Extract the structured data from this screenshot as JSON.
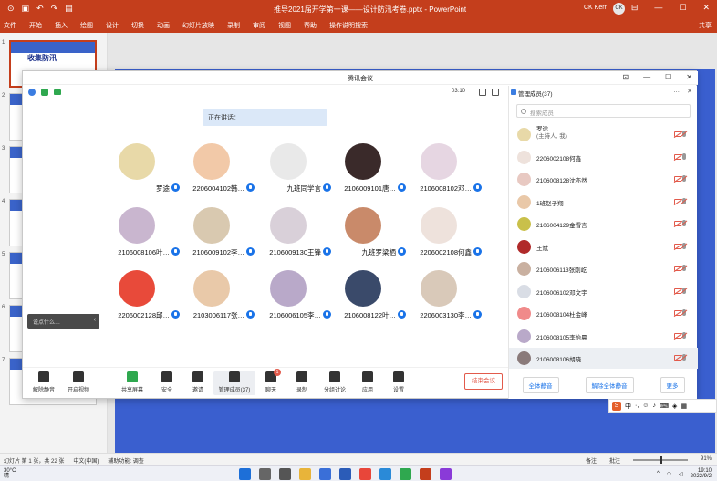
{
  "ppt": {
    "doc_title": "推导2021届开学第一课——设计防汛考卷.pptx - PowerPoint",
    "user_name": "CK Kerr",
    "user_initials": "CK",
    "share": "共享",
    "tabs": [
      "文件",
      "开始",
      "插入",
      "绘图",
      "设计",
      "切换",
      "动画",
      "幻灯片放映",
      "录制",
      "审阅",
      "视图",
      "帮助",
      "操作说明搜索"
    ],
    "thumb_badge": "收集防汛",
    "thumb_numbers": [
      "1",
      "2",
      "3",
      "4",
      "5",
      "6",
      "7"
    ],
    "status_left": [
      "幻灯片 第 1 张，共 22 张",
      "中文(中国)",
      "辅助功能: 调查"
    ],
    "status_right": [
      "备注",
      "批注",
      "91%"
    ]
  },
  "meeting": {
    "title": "腾讯会议",
    "timer": "03:10",
    "toast": "正在讲话：",
    "participants_grid": [
      {
        "label": "罗途",
        "pic": "#e8d9a8"
      },
      {
        "label": "2206004102韩…",
        "pic": "#f2c9a8"
      },
      {
        "label": "九班同学言",
        "pic": "#e9e9e9"
      },
      {
        "label": "2106009101唐…",
        "pic": "#3a2a2a"
      },
      {
        "label": "2106008102邓…",
        "pic": "#e6d6e2"
      },
      {
        "label": "2106008106叶…",
        "pic": "#c9b6cf"
      },
      {
        "label": "2106009102李…",
        "pic": "#d9c9b0"
      },
      {
        "label": "2106009130王锋",
        "pic": "#d9d0d9"
      },
      {
        "label": "九班罗梁栖",
        "pic": "#c98a6a"
      },
      {
        "label": "2206002108何鑫",
        "pic": "#eee2dc"
      },
      {
        "label": "2206002128邱…",
        "pic": "#e84a3a"
      },
      {
        "label": "2103006117张…",
        "pic": "#e9c9a9"
      },
      {
        "label": "2106006105李…",
        "pic": "#b9a9c9"
      },
      {
        "label": "2106008122叶…",
        "pic": "#3a4a6a"
      },
      {
        "label": "2206003130李…",
        "pic": "#d9c9b9"
      }
    ],
    "chat_placeholder": "说点什么…",
    "bottom_bar": [
      {
        "label": "解除静音",
        "icon": "mic-muted-icon"
      },
      {
        "label": "开启视频",
        "icon": "video-off-icon"
      },
      {
        "label": "共享屏幕",
        "icon": "share-screen-icon"
      },
      {
        "label": "安全",
        "icon": "shield-icon"
      },
      {
        "label": "邀请",
        "icon": "invite-icon"
      },
      {
        "label": "管理成员(37)",
        "icon": "members-icon"
      },
      {
        "label": "聊天",
        "icon": "chat-icon"
      },
      {
        "label": "录制",
        "icon": "record-icon"
      },
      {
        "label": "分组讨论",
        "icon": "breakout-icon"
      },
      {
        "label": "应用",
        "icon": "apps-icon"
      },
      {
        "label": "设置",
        "icon": "settings-icon"
      }
    ],
    "chat_badge": "1",
    "end_label": "结束会议"
  },
  "panel": {
    "title": "管理成员(37)",
    "search_placeholder": "搜索成员",
    "members": [
      {
        "name": "罗途",
        "sub": "(主持人, 我)",
        "color": "#e8d9a8",
        "mic": "muted"
      },
      {
        "name": "2206002108何鑫",
        "sub": "",
        "color": "#eee2dc",
        "mic": "on"
      },
      {
        "name": "2106008128沈亦然",
        "sub": "",
        "color": "#e8c9c2",
        "mic": "muted"
      },
      {
        "name": "1班赵子翔",
        "sub": "",
        "color": "#e9c8a8",
        "mic": "muted"
      },
      {
        "name": "2106004129金雪言",
        "sub": "",
        "color": "#c9c04a",
        "mic": "muted"
      },
      {
        "name": "王斌",
        "sub": "",
        "color": "#b02a2a",
        "mic": "muted"
      },
      {
        "name": "2106006113张刚屹",
        "sub": "",
        "color": "#c9b0a0",
        "mic": "muted"
      },
      {
        "name": "2106006102邓文宇",
        "sub": "",
        "color": "#d9dde5",
        "mic": "muted"
      },
      {
        "name": "2106008104杜金峰",
        "sub": "",
        "color": "#f08a8a",
        "mic": "muted"
      },
      {
        "name": "2106008105李怡晨",
        "sub": "",
        "color": "#b9a9c9",
        "mic": "muted"
      },
      {
        "name": "2106008106胡晓",
        "sub": "",
        "color": "#8a7a7a",
        "mic": "muted"
      }
    ],
    "footer": [
      "全体静音",
      "解除全体静音",
      "更多"
    ]
  },
  "taskbar": {
    "temp": "30°C",
    "weather": "晴",
    "time": "19:10",
    "date": "2022/9/2",
    "apps": [
      "start-icon",
      "search-icon",
      "task-view-icon",
      "files-icon",
      "store-icon",
      "word-icon",
      "chrome-icon",
      "edge-icon",
      "meeting-icon",
      "powerpoint-icon",
      "video-icon"
    ]
  },
  "ime": {
    "lang": "中",
    "items": [
      "ime-punct-icon",
      "ime-emoji-icon",
      "ime-mic-icon",
      "ime-keyboard-icon",
      "ime-skin-icon",
      "ime-tools-icon"
    ]
  }
}
